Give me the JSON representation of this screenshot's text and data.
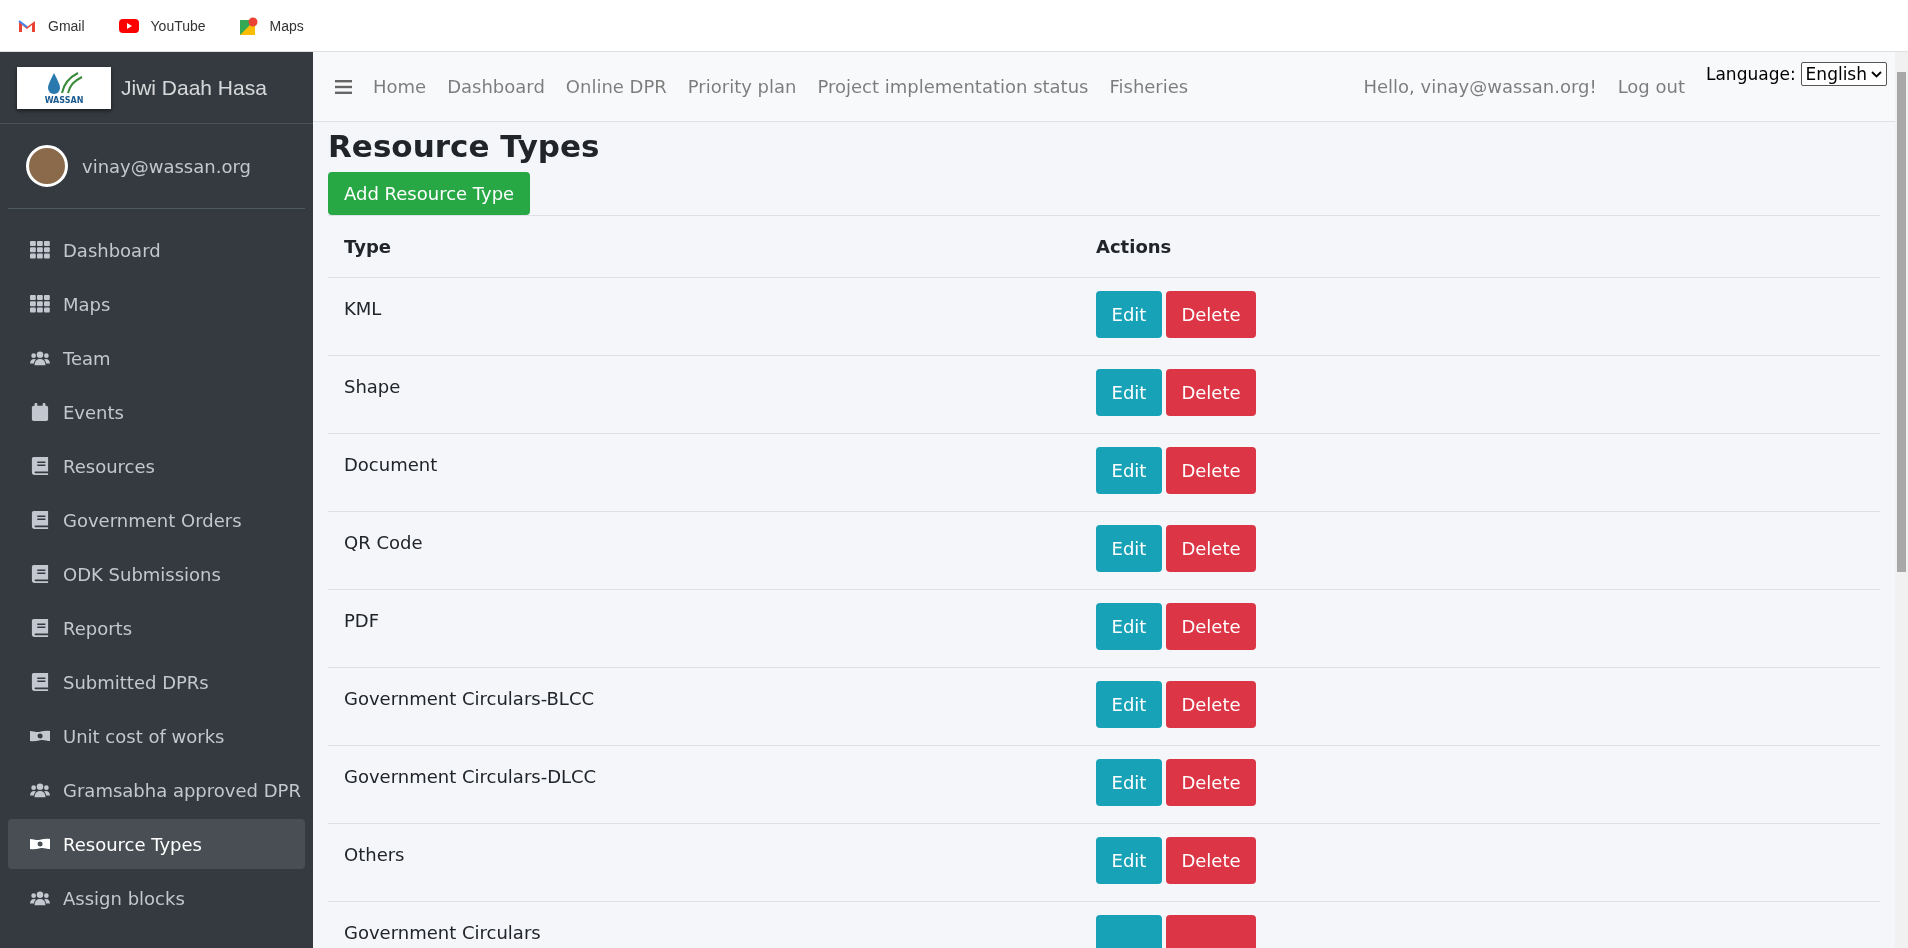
{
  "bookmarks": [
    {
      "label": "Gmail",
      "kind": "gmail"
    },
    {
      "label": "YouTube",
      "kind": "youtube"
    },
    {
      "label": "Maps",
      "kind": "maps"
    }
  ],
  "sidebar": {
    "logo_text": "WASSAN",
    "brand": "Jiwi Daah Hasa",
    "user": "vinay@wassan.org",
    "items": [
      {
        "label": "Dashboard",
        "kind": "grid",
        "selected": false
      },
      {
        "label": "Maps",
        "kind": "grid",
        "selected": false
      },
      {
        "label": "Team",
        "kind": "users",
        "selected": false
      },
      {
        "label": "Events",
        "kind": "calendar",
        "selected": false
      },
      {
        "label": "Resources",
        "kind": "book",
        "selected": false
      },
      {
        "label": "Government Orders",
        "kind": "book",
        "selected": false
      },
      {
        "label": "ODK Submissions",
        "kind": "book",
        "selected": false
      },
      {
        "label": "Reports",
        "kind": "book",
        "selected": false
      },
      {
        "label": "Submitted DPRs",
        "kind": "book",
        "selected": false
      },
      {
        "label": "Unit cost of works",
        "kind": "money",
        "selected": false
      },
      {
        "label": "Gramsabha approved DPR",
        "kind": "users",
        "selected": false
      },
      {
        "label": "Resource Types",
        "kind": "money",
        "selected": true
      },
      {
        "label": "Assign blocks",
        "kind": "users",
        "selected": false
      }
    ]
  },
  "navbar": {
    "links": [
      "Home",
      "Dashboard",
      "Online DPR",
      "Priority plan",
      "Project implementation status",
      "Fisheries"
    ],
    "greeting": "Hello, vinay@wassan.org!",
    "logout": "Log out",
    "language_label": "Language:",
    "language": "English"
  },
  "page": {
    "title": "Resource Types",
    "add_button": "Add Resource Type",
    "columns": [
      "Type",
      "Actions"
    ],
    "rows": [
      {
        "type": "KML",
        "edit": "Edit",
        "delete": "Delete"
      },
      {
        "type": "Shape",
        "edit": "Edit",
        "delete": "Delete"
      },
      {
        "type": "Document",
        "edit": "Edit",
        "delete": "Delete"
      },
      {
        "type": "QR Code",
        "edit": "Edit",
        "delete": "Delete"
      },
      {
        "type": "PDF",
        "edit": "Edit",
        "delete": "Delete"
      },
      {
        "type": "Government Circulars-BLCC",
        "edit": "Edit",
        "delete": "Delete"
      },
      {
        "type": "Government Circulars-DLCC",
        "edit": "Edit",
        "delete": "Delete"
      },
      {
        "type": "Others",
        "edit": "Edit",
        "delete": "Delete"
      },
      {
        "type": "Government Circulars"
      }
    ]
  }
}
